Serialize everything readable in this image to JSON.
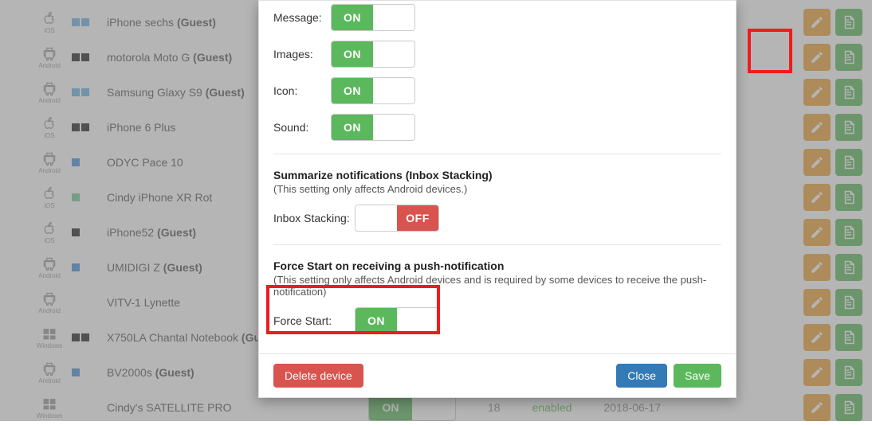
{
  "devices": [
    {
      "os": "ios",
      "os_label": "iOS",
      "swatches": [
        "#6cb2e4",
        "#6cb2e4"
      ],
      "name": "iPhone sechs",
      "guest": true
    },
    {
      "os": "android",
      "os_label": "Android",
      "swatches": [
        "#222",
        "#222"
      ],
      "name": "motorola Moto G",
      "guest": true
    },
    {
      "os": "android",
      "os_label": "Android",
      "swatches": [
        "#6cb2e4",
        "#6cb2e4"
      ],
      "name": "Samsung Glaxy S9",
      "guest": true
    },
    {
      "os": "ios",
      "os_label": "iOS",
      "swatches": [
        "#222",
        "#222"
      ],
      "name": "iPhone 6 Plus",
      "guest": false
    },
    {
      "os": "android",
      "os_label": "Android",
      "swatches": [
        "#4a90d9"
      ],
      "name": "ODYC Pace 10",
      "guest": false
    },
    {
      "os": "ios",
      "os_label": "iOS",
      "swatches": [
        "#6fcf97"
      ],
      "name": "Cindy iPhone XR Rot",
      "guest": false
    },
    {
      "os": "ios",
      "os_label": "iOS",
      "swatches": [
        "#222"
      ],
      "name": "iPhone52",
      "guest": true
    },
    {
      "os": "android",
      "os_label": "Android",
      "swatches": [
        "#4a90d9"
      ],
      "name": "UMIDIGI Z",
      "guest": true
    },
    {
      "os": "android",
      "os_label": "Android",
      "swatches": [],
      "name": "VITV-1 Lynette",
      "guest": false
    },
    {
      "os": "windows",
      "os_label": "Windows",
      "swatches": [
        "#222",
        "#222"
      ],
      "name": "X750LA Chantal Notebook",
      "guest": true
    },
    {
      "os": "android",
      "os_label": "Android",
      "swatches": [
        "#4a90d9"
      ],
      "name": "BV2000s",
      "guest": true
    },
    {
      "os": "windows",
      "os_label": "Windows",
      "swatches": [],
      "name": "Cindy's SATELLITE PRO",
      "guest": false,
      "extra": {
        "toggle_on": true,
        "count": "18",
        "status": "enabled",
        "date": "2018-06-17"
      }
    }
  ],
  "guest_suffix": "(Guest)",
  "modal": {
    "rows": {
      "message_label": "Message:",
      "images_label": "Images:",
      "icon_label": "Icon:",
      "sound_label": "Sound:"
    },
    "toggle_on": "ON",
    "toggle_off": "OFF",
    "section1_title": "Summarize notifications (Inbox Stacking)",
    "section1_sub": "(This setting only affects Android devices.)",
    "inbox_label": "Inbox Stacking:",
    "section2_title": "Force Start on receiving a push-notification",
    "section2_sub": "(This setting only affects Android devices and is required by some devices to receive the push-notification)",
    "force_label": "Force Start:",
    "delete_btn": "Delete device",
    "close_btn": "Close",
    "save_btn": "Save"
  }
}
